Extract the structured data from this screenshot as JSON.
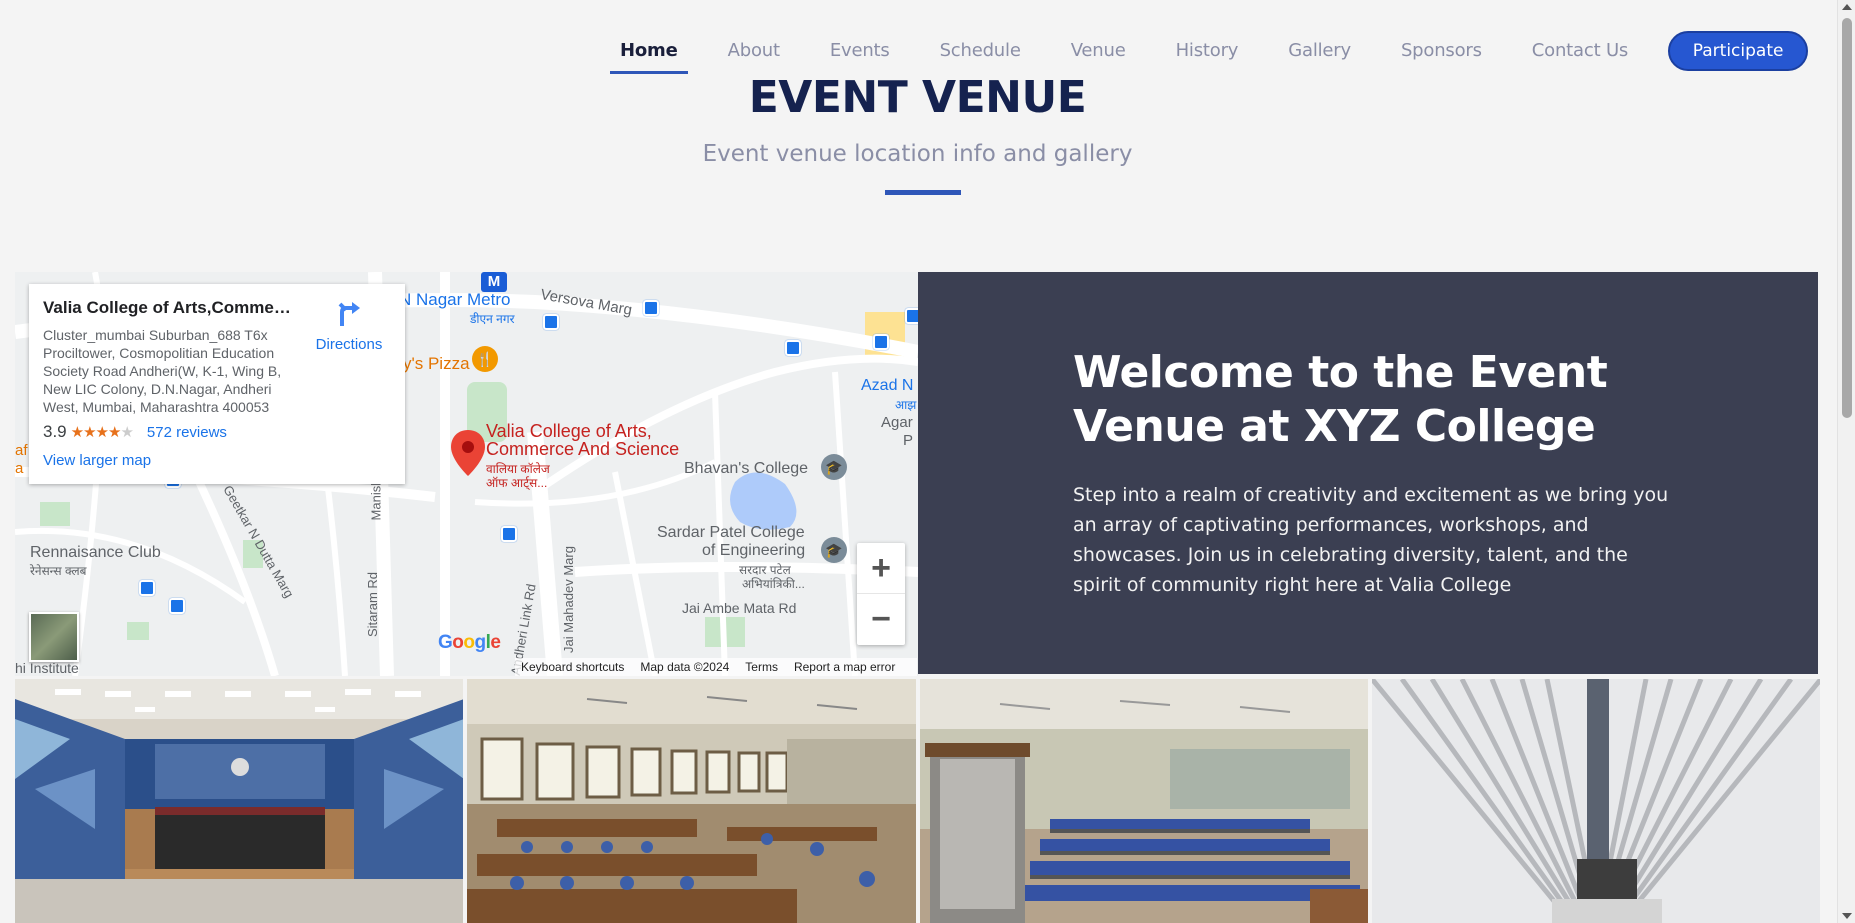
{
  "nav": {
    "items": [
      {
        "label": "Home",
        "active": true
      },
      {
        "label": "About"
      },
      {
        "label": "Events"
      },
      {
        "label": "Schedule"
      },
      {
        "label": "Venue"
      },
      {
        "label": "History"
      },
      {
        "label": "Gallery"
      },
      {
        "label": "Sponsors"
      },
      {
        "label": "Contact Us"
      }
    ],
    "cta_label": "Participate"
  },
  "header": {
    "title": "EVENT VENUE",
    "subtitle": "Event venue location info and gallery"
  },
  "map": {
    "card": {
      "name": "Valia College of Arts,Commer...",
      "address": "Cluster_mumbai Suburban_688 T6x Prociltower, Cosmopolitian Education Society Road Andheri(W, K-1, Wing B, New LIC Colony, D.N.Nagar, Andheri West, Mumbai, Maharashtra 400053",
      "rating": "3.9",
      "stars_filled": 4,
      "reviews": "572 reviews",
      "larger_map": "View larger map",
      "directions": "Directions"
    },
    "labels": {
      "metro": "N Nagar Metro",
      "metro_dev": "डीएन नगर",
      "versova": "Versova Marg",
      "pizza": "y's Pizza",
      "place_line1": "Valia College of Arts,",
      "place_line2": "Commerce And Science",
      "place_dev1": "वालिया कॉलेज",
      "place_dev2": "ऑफ आर्ट्स...",
      "bhavans": "Bhavan's College",
      "sardar1": "Sardar Patel College",
      "sardar2": "of Engineering",
      "sardar_dev1": "सरदार पटेल",
      "sardar_dev2": "अभियांत्रिकी...",
      "rennaisance": "Rennaisance Club",
      "rennaisance_dev": "रेनेसन्स क्लब",
      "geetkar": "Geetkar N Dutta Marg",
      "manish": "Manish",
      "sitaram": "Sitaram Rd",
      "andheri_link": "Andheri Link Rd",
      "mahadev": "Jai Mahadev Marg",
      "ambe": "Jai Ambe Mata Rd",
      "azad": "Azad N",
      "azad_dev": "आझ",
      "agar": "Agar",
      "agar2": "P",
      "institute": "hi Institute",
      "edge_af": "af",
      "edge_a": "a",
      "metro_m": "M"
    },
    "google": "Google",
    "footer": [
      "Keyboard shortcuts",
      "Map data ©2024",
      "Terms",
      "Report a map error"
    ],
    "zoom_in": "+",
    "zoom_out": "−"
  },
  "welcome": {
    "heading": "Welcome to the Event Venue at XYZ College",
    "body": "Step into a realm of creativity and excitement as we bring you an array of captivating performances, workshops, and showcases. Join us in celebrating diversity, talent, and the spirit of community right here at Valia College"
  },
  "colors": {
    "accent": "#2e56b8",
    "button": "#2657d1",
    "title": "#15224f",
    "panel": "#3b3f52"
  }
}
